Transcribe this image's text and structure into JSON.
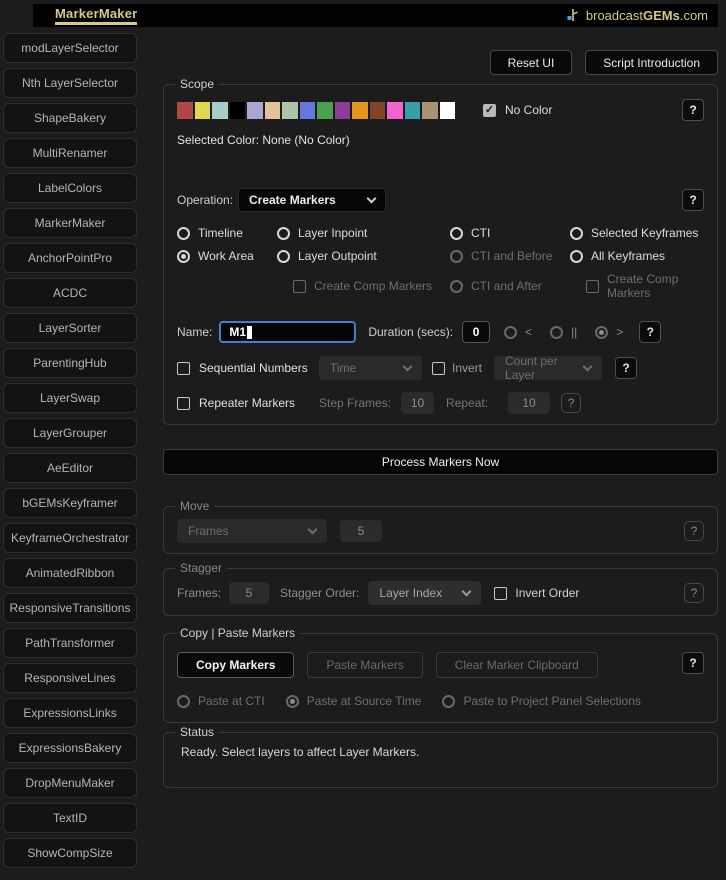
{
  "colors": {
    "brand_tan": "#d5c88b",
    "focus_blue": "#3f80cf",
    "background": "#1c1c1c"
  },
  "icons": {
    "check": "✓",
    "help": "?"
  },
  "header": {
    "logo_text": "MarkerMaker",
    "brand_prefix": "broadcast",
    "brand_bold": "GEMs",
    "brand_suffix": ".com"
  },
  "sidebar": {
    "items": [
      "modLayerSelector",
      "Nth LayerSelector",
      "ShapeBakery",
      "MultiRenamer",
      "LabelColors",
      "MarkerMaker",
      "AnchorPointPro",
      "ACDC",
      "LayerSorter",
      "ParentingHub",
      "LayerSwap",
      "LayerGrouper",
      "AeEditor",
      "bGEMsKeyframer",
      "KeyframeOrchestrator",
      "AnimatedRibbon",
      "ResponsiveTransitions",
      "PathTransformer",
      "ResponsiveLines",
      "ExpressionsLinks",
      "ExpressionsBakery",
      "DropMenuMaker",
      "TextID",
      "ShowCompSize"
    ]
  },
  "actions": {
    "reset_ui": "Reset UI",
    "script_introduction": "Script Introduction"
  },
  "scope": {
    "legend": "Scope",
    "swatches": [
      {
        "name": "red",
        "color": "#b14747"
      },
      {
        "name": "yellow",
        "color": "#e0d84f"
      },
      {
        "name": "aqua",
        "color": "#a8cdc8"
      },
      {
        "name": "black",
        "color": "#000000"
      },
      {
        "name": "lavender",
        "color": "#a9a7d1"
      },
      {
        "name": "peach",
        "color": "#e6c096"
      },
      {
        "name": "sea-foam",
        "color": "#aec3ab"
      },
      {
        "name": "blue",
        "color": "#6678e0"
      },
      {
        "name": "green",
        "color": "#4ba04b"
      },
      {
        "name": "purple",
        "color": "#8e3d96"
      },
      {
        "name": "orange",
        "color": "#e3941d"
      },
      {
        "name": "brown",
        "color": "#7e4527"
      },
      {
        "name": "fuchsia",
        "color": "#f263d2"
      },
      {
        "name": "cyan",
        "color": "#3c9ca8"
      },
      {
        "name": "sandstone",
        "color": "#aa9372"
      },
      {
        "name": "white",
        "color": "#ffffff"
      }
    ],
    "no_color": {
      "label": "No Color",
      "checked": true
    },
    "selected_color_text": "Selected Color: None (No Color)",
    "help": "?"
  },
  "operation": {
    "label": "Operation:",
    "value": "Create Markers",
    "help": "?",
    "placement_options": [
      {
        "label": "Timeline",
        "control": "radio",
        "selected": false,
        "enabled": true
      },
      {
        "label": "Layer Inpoint",
        "control": "radio",
        "selected": false,
        "enabled": true
      },
      {
        "label": "CTI",
        "control": "radio",
        "selected": false,
        "enabled": true
      },
      {
        "label": "Selected Keyframes",
        "control": "radio",
        "selected": false,
        "enabled": true
      },
      {
        "label": "Work Area",
        "control": "radio",
        "selected": true,
        "enabled": true
      },
      {
        "label": "Layer Outpoint",
        "control": "radio",
        "selected": false,
        "enabled": true
      },
      {
        "label": "CTI and Before",
        "control": "radio",
        "selected": false,
        "enabled": false
      },
      {
        "label": "All Keyframes",
        "control": "radio",
        "selected": false,
        "enabled": true
      },
      {
        "label": "Create Comp Markers",
        "control": "checkbox",
        "selected": false,
        "enabled": false
      },
      {
        "label": "CTI and After",
        "control": "radio",
        "selected": false,
        "enabled": false
      },
      {
        "label": "Create Comp Markers",
        "control": "checkbox",
        "selected": false,
        "enabled": false
      }
    ]
  },
  "marker": {
    "name_label": "Name:",
    "name_value": "M1",
    "duration_label": "Duration (secs):",
    "duration_value": "0",
    "duration_modes": [
      {
        "symbol": "<",
        "selected": false
      },
      {
        "symbol": "||",
        "selected": false
      },
      {
        "symbol": ">",
        "selected": true
      }
    ],
    "help": "?"
  },
  "sequential": {
    "label": "Sequential Numbers",
    "checked": false,
    "mode_value": "Time",
    "invert_label": "Invert",
    "invert_checked": false,
    "count_value": "Count per Layer",
    "help": "?"
  },
  "repeater": {
    "label": "Repeater Markers",
    "checked": false,
    "step_label": "Step Frames:",
    "step_value": "10",
    "repeat_label": "Repeat:",
    "repeat_value": "10",
    "help": "?"
  },
  "process": {
    "label": "Process Markers Now"
  },
  "move": {
    "legend": "Move",
    "unit_value": "Frames",
    "amount_value": "5",
    "help": "?"
  },
  "stagger": {
    "legend": "Stagger",
    "frames_label": "Frames:",
    "frames_value": "5",
    "order_label": "Stagger Order:",
    "order_value": "Layer Index",
    "invert_label": "Invert Order",
    "invert_checked": false,
    "help": "?"
  },
  "copy_paste": {
    "legend": "Copy | Paste Markers",
    "copy_label": "Copy Markers",
    "paste_label": "Paste Markers",
    "clear_label": "Clear Marker Clipboard",
    "help": "?",
    "paste_modes": [
      {
        "label": "Paste at CTI",
        "selected": false
      },
      {
        "label": "Paste at Source Time",
        "selected": true
      },
      {
        "label": "Paste to Project Panel Selections",
        "selected": false
      }
    ]
  },
  "status": {
    "legend": "Status",
    "text": "Ready. Select layers to affect Layer Markers."
  }
}
